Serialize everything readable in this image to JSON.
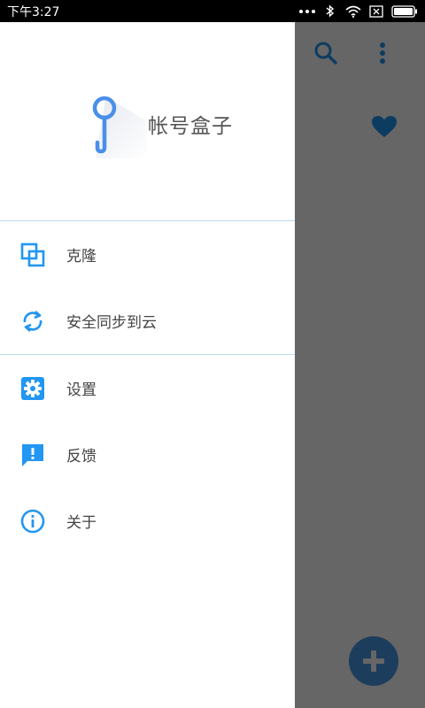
{
  "status_bar": {
    "time": "下午3:27"
  },
  "app": {
    "accent_color": "#2196f3",
    "icons": {
      "search": "search-icon",
      "more": "more-vert-icon",
      "favorite": "heart-icon",
      "fab": "plus-icon"
    }
  },
  "drawer": {
    "app_name": "帐号盒子",
    "groups": [
      [
        {
          "label": "克隆",
          "icon": "clone-icon"
        },
        {
          "label": "安全同步到云",
          "icon": "sync-icon"
        }
      ],
      [
        {
          "label": "设置",
          "icon": "gear-icon"
        },
        {
          "label": "反馈",
          "icon": "feedback-icon"
        },
        {
          "label": "关于",
          "icon": "info-icon"
        }
      ]
    ]
  }
}
